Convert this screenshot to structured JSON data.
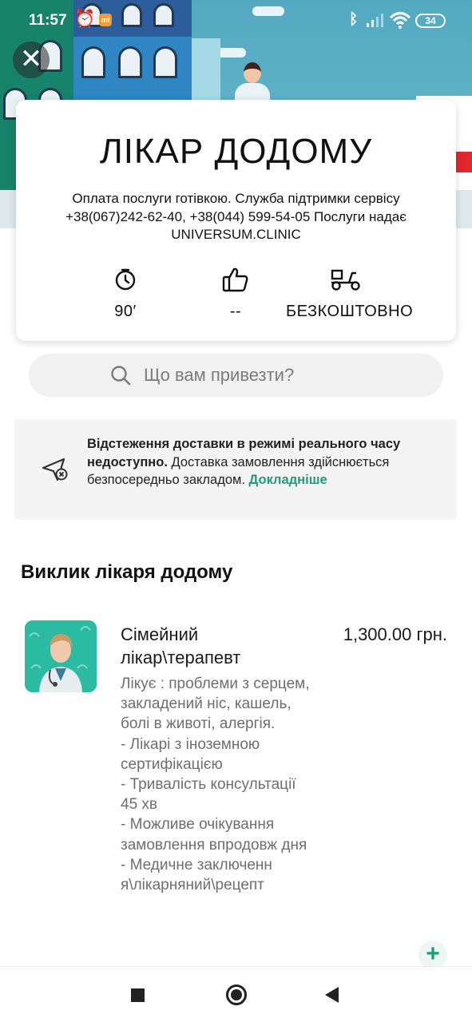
{
  "status_bar": {
    "time": "11:57",
    "battery": "34",
    "icons": [
      "alarm-icon",
      "mi-notification-icon",
      "bluetooth-icon",
      "signal-icon",
      "wifi-icon",
      "battery-icon"
    ]
  },
  "header": {
    "close_icon": "close-icon"
  },
  "store": {
    "title": "ЛІКАР ДОДОМУ",
    "description": "Оплата послуги готівкою. Служба підтримки сервісу +38(067)242-62-40, +38(044) 599-54-05 Послуги надає UNIVERSUM.CLINIC",
    "metrics": [
      {
        "icon": "clock-icon",
        "value": "90′"
      },
      {
        "icon": "thumbs-up-icon",
        "value": "--"
      },
      {
        "icon": "delivery-scooter-icon",
        "value": "БЕЗКОШТОВНО"
      }
    ]
  },
  "search": {
    "placeholder": "Що вам привезти?"
  },
  "banner": {
    "strong_text": "Відстеження доставки в режимі реального часу недоступно.",
    "text": " Доставка замовлення здійснюється безпосередньо закладом.",
    "link": "Докладніше"
  },
  "section": {
    "title": "Виклик лікаря додому"
  },
  "items": [
    {
      "name": "Сімейний лікар\\терапевт",
      "price": "1,300.00 грн.",
      "description": "Лікує : проблеми з серцем, закладений ніс, кашель, болі в животі, алергія.\n- Лікарі з іноземною сертифікацією\n- Тривалість консультації 45 хв\n- Можливе очікування замовлення впродовж дня\n- Медичне заключенн я\\лікарняний\\рецепт",
      "add_label": "+"
    }
  ],
  "colors": {
    "accent": "#1d9d7a",
    "banner_bg": "#f4f4f4",
    "search_bg": "#f1f1f1"
  }
}
